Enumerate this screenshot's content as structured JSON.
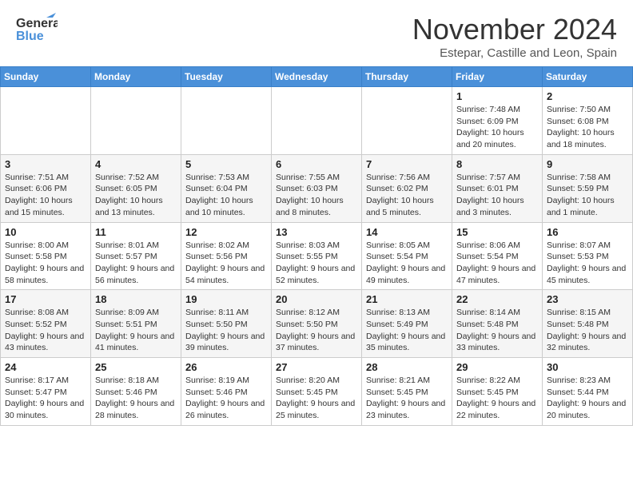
{
  "header": {
    "logo_line1": "General",
    "logo_line2": "Blue",
    "month": "November 2024",
    "location": "Estepar, Castille and Leon, Spain"
  },
  "calendar": {
    "weekdays": [
      "Sunday",
      "Monday",
      "Tuesday",
      "Wednesday",
      "Thursday",
      "Friday",
      "Saturday"
    ],
    "weeks": [
      [
        {
          "day": "",
          "info": ""
        },
        {
          "day": "",
          "info": ""
        },
        {
          "day": "",
          "info": ""
        },
        {
          "day": "",
          "info": ""
        },
        {
          "day": "",
          "info": ""
        },
        {
          "day": "1",
          "info": "Sunrise: 7:48 AM\nSunset: 6:09 PM\nDaylight: 10 hours and 20 minutes."
        },
        {
          "day": "2",
          "info": "Sunrise: 7:50 AM\nSunset: 6:08 PM\nDaylight: 10 hours and 18 minutes."
        }
      ],
      [
        {
          "day": "3",
          "info": "Sunrise: 7:51 AM\nSunset: 6:06 PM\nDaylight: 10 hours and 15 minutes."
        },
        {
          "day": "4",
          "info": "Sunrise: 7:52 AM\nSunset: 6:05 PM\nDaylight: 10 hours and 13 minutes."
        },
        {
          "day": "5",
          "info": "Sunrise: 7:53 AM\nSunset: 6:04 PM\nDaylight: 10 hours and 10 minutes."
        },
        {
          "day": "6",
          "info": "Sunrise: 7:55 AM\nSunset: 6:03 PM\nDaylight: 10 hours and 8 minutes."
        },
        {
          "day": "7",
          "info": "Sunrise: 7:56 AM\nSunset: 6:02 PM\nDaylight: 10 hours and 5 minutes."
        },
        {
          "day": "8",
          "info": "Sunrise: 7:57 AM\nSunset: 6:01 PM\nDaylight: 10 hours and 3 minutes."
        },
        {
          "day": "9",
          "info": "Sunrise: 7:58 AM\nSunset: 5:59 PM\nDaylight: 10 hours and 1 minute."
        }
      ],
      [
        {
          "day": "10",
          "info": "Sunrise: 8:00 AM\nSunset: 5:58 PM\nDaylight: 9 hours and 58 minutes."
        },
        {
          "day": "11",
          "info": "Sunrise: 8:01 AM\nSunset: 5:57 PM\nDaylight: 9 hours and 56 minutes."
        },
        {
          "day": "12",
          "info": "Sunrise: 8:02 AM\nSunset: 5:56 PM\nDaylight: 9 hours and 54 minutes."
        },
        {
          "day": "13",
          "info": "Sunrise: 8:03 AM\nSunset: 5:55 PM\nDaylight: 9 hours and 52 minutes."
        },
        {
          "day": "14",
          "info": "Sunrise: 8:05 AM\nSunset: 5:54 PM\nDaylight: 9 hours and 49 minutes."
        },
        {
          "day": "15",
          "info": "Sunrise: 8:06 AM\nSunset: 5:54 PM\nDaylight: 9 hours and 47 minutes."
        },
        {
          "day": "16",
          "info": "Sunrise: 8:07 AM\nSunset: 5:53 PM\nDaylight: 9 hours and 45 minutes."
        }
      ],
      [
        {
          "day": "17",
          "info": "Sunrise: 8:08 AM\nSunset: 5:52 PM\nDaylight: 9 hours and 43 minutes."
        },
        {
          "day": "18",
          "info": "Sunrise: 8:09 AM\nSunset: 5:51 PM\nDaylight: 9 hours and 41 minutes."
        },
        {
          "day": "19",
          "info": "Sunrise: 8:11 AM\nSunset: 5:50 PM\nDaylight: 9 hours and 39 minutes."
        },
        {
          "day": "20",
          "info": "Sunrise: 8:12 AM\nSunset: 5:50 PM\nDaylight: 9 hours and 37 minutes."
        },
        {
          "day": "21",
          "info": "Sunrise: 8:13 AM\nSunset: 5:49 PM\nDaylight: 9 hours and 35 minutes."
        },
        {
          "day": "22",
          "info": "Sunrise: 8:14 AM\nSunset: 5:48 PM\nDaylight: 9 hours and 33 minutes."
        },
        {
          "day": "23",
          "info": "Sunrise: 8:15 AM\nSunset: 5:48 PM\nDaylight: 9 hours and 32 minutes."
        }
      ],
      [
        {
          "day": "24",
          "info": "Sunrise: 8:17 AM\nSunset: 5:47 PM\nDaylight: 9 hours and 30 minutes."
        },
        {
          "day": "25",
          "info": "Sunrise: 8:18 AM\nSunset: 5:46 PM\nDaylight: 9 hours and 28 minutes."
        },
        {
          "day": "26",
          "info": "Sunrise: 8:19 AM\nSunset: 5:46 PM\nDaylight: 9 hours and 26 minutes."
        },
        {
          "day": "27",
          "info": "Sunrise: 8:20 AM\nSunset: 5:45 PM\nDaylight: 9 hours and 25 minutes."
        },
        {
          "day": "28",
          "info": "Sunrise: 8:21 AM\nSunset: 5:45 PM\nDaylight: 9 hours and 23 minutes."
        },
        {
          "day": "29",
          "info": "Sunrise: 8:22 AM\nSunset: 5:45 PM\nDaylight: 9 hours and 22 minutes."
        },
        {
          "day": "30",
          "info": "Sunrise: 8:23 AM\nSunset: 5:44 PM\nDaylight: 9 hours and 20 minutes."
        }
      ]
    ]
  }
}
